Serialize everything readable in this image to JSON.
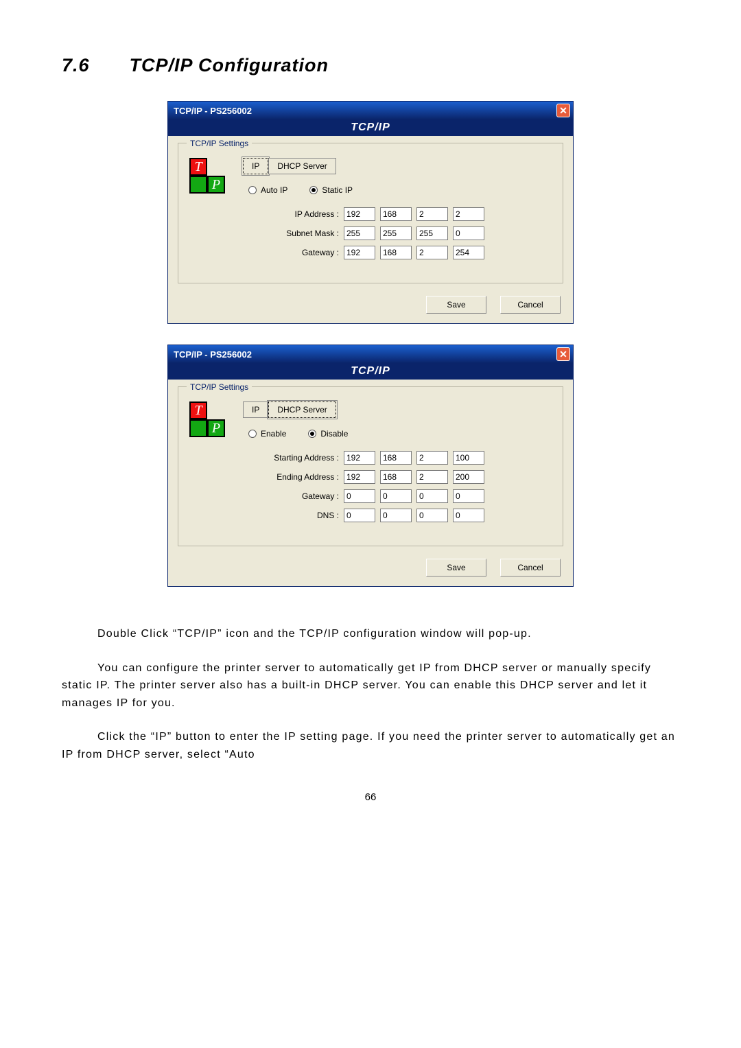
{
  "heading_num": "7.6",
  "heading_text": "TCP/IP Configuration",
  "dialog1": {
    "title": "TCP/IP - PS256002",
    "band": "TCP/IP",
    "legend": "TCP/IP Settings",
    "tab_ip": "IP",
    "tab_dhcp": "DHCP Server",
    "radio_auto": "Auto IP",
    "radio_static": "Static IP",
    "rows": {
      "ip_label": "IP Address :",
      "ip": [
        "192",
        "168",
        "2",
        "2"
      ],
      "mask_label": "Subnet Mask :",
      "mask": [
        "255",
        "255",
        "255",
        "0"
      ],
      "gw_label": "Gateway :",
      "gw": [
        "192",
        "168",
        "2",
        "254"
      ]
    },
    "save": "Save",
    "cancel": "Cancel"
  },
  "dialog2": {
    "title": "TCP/IP - PS256002",
    "band": "TCP/IP",
    "legend": "TCP/IP Settings",
    "tab_ip": "IP",
    "tab_dhcp": "DHCP Server",
    "radio_enable": "Enable",
    "radio_disable": "Disable",
    "rows": {
      "start_label": "Starting Address :",
      "start": [
        "192",
        "168",
        "2",
        "100"
      ],
      "end_label": "Ending Address :",
      "end": [
        "192",
        "168",
        "2",
        "200"
      ],
      "gw_label": "Gateway :",
      "gw": [
        "0",
        "0",
        "0",
        "0"
      ],
      "dns_label": "DNS :",
      "dns": [
        "0",
        "0",
        "0",
        "0"
      ]
    },
    "save": "Save",
    "cancel": "Cancel"
  },
  "para1": "Double Click “TCP/IP” icon and the TCP/IP configuration window will pop-up.",
  "para2": "You can configure the printer server to automatically get IP from DHCP server or manually specify static IP. The printer server also has a built-in DHCP server. You can enable this DHCP server and let it manages IP for you.",
  "para3": "Click the “IP” button to enter the IP setting page. If you need the printer server to automatically get an IP from DHCP server, select “Auto",
  "page_num": "66"
}
